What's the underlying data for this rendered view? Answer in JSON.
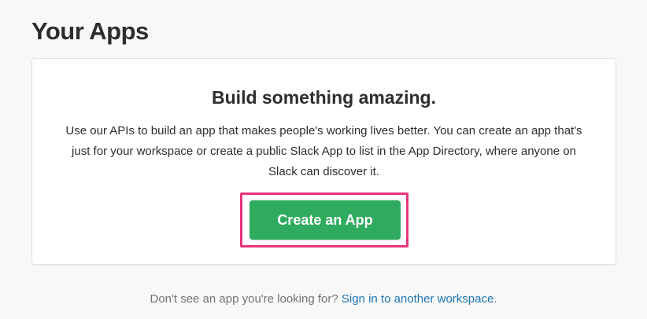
{
  "page": {
    "title": "Your Apps"
  },
  "card": {
    "heading": "Build something amazing.",
    "description": "Use our APIs to build an app that makes people's working lives better. You can create an app that's just for your workspace or create a public Slack App to list in the App Directory, where anyone on Slack can discover it.",
    "create_button_label": "Create an App"
  },
  "footer": {
    "prompt": "Don't see an app you're looking for? ",
    "link_label": "Sign in to another workspace",
    "trailing": "."
  },
  "colors": {
    "primary_button": "#2eab5f",
    "highlight": "#e8357a",
    "link": "#1d76b3"
  }
}
